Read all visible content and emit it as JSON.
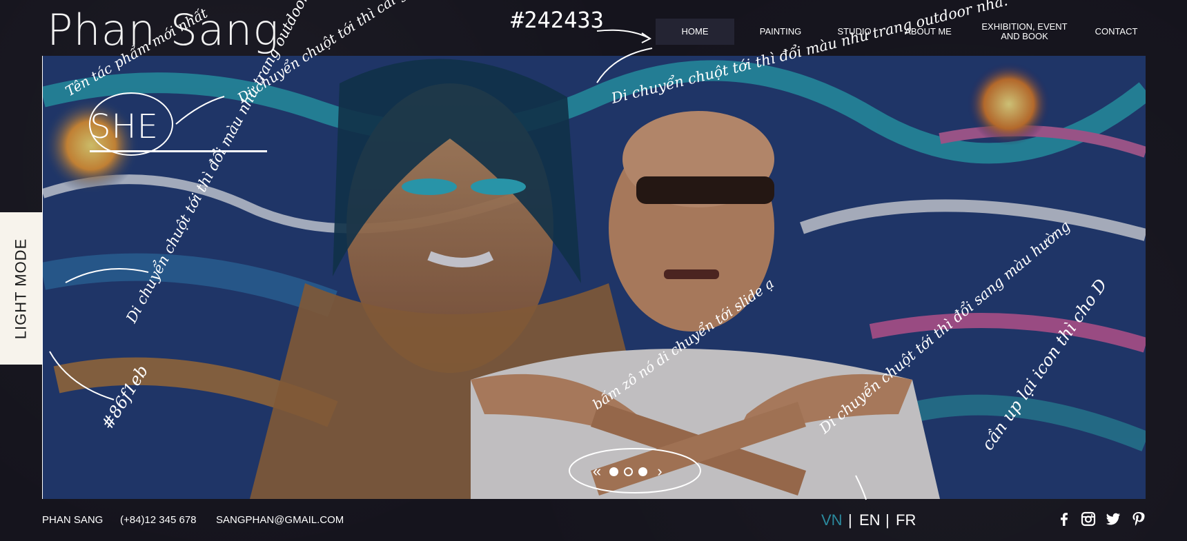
{
  "site": {
    "logo": "Phan Sang"
  },
  "nav": {
    "items": [
      {
        "label": "HOME",
        "active": true
      },
      {
        "label": "PAINTING",
        "active": false
      },
      {
        "label": "STUDIO",
        "active": false
      },
      {
        "label": "ABOUT ME",
        "active": false
      },
      {
        "label": "EXHIBITION, EVENT AND BOOK",
        "active": false
      },
      {
        "label": "CONTACT",
        "active": false
      }
    ],
    "active_bg": "#242433"
  },
  "hero": {
    "slide_title": "SHE",
    "slides_total": 3,
    "current_slide": 1,
    "prev_icon": "double-chevron-left-icon",
    "next_icon": "chevron-right-icon"
  },
  "mode_toggle": {
    "label": "LIGHT MODE"
  },
  "footer": {
    "name": "PHAN SANG",
    "phone": "(+84)12 345 678",
    "email": "SANGPHAN@GMAIL.COM",
    "languages": [
      {
        "code": "VN",
        "active": true
      },
      {
        "code": "EN",
        "active": false
      },
      {
        "code": "FR",
        "active": false
      }
    ],
    "separator": "|",
    "active_lang_color": "#2b8a9e",
    "social": [
      "facebook-icon",
      "instagram-icon",
      "twitter-icon",
      "pinterest-icon"
    ]
  },
  "annotations": {
    "color_code_top": "#242433",
    "color_code_left": "#86f1eb",
    "notes": [
      "Tên tác phẩm mới nhất",
      "Di chuyển chuột tới thì cái gạch chân nó mới thụt ra nha",
      "Di chuyển chuột tới thì đổi màu như trang outdoor nha.",
      "Di chuyển chuột tới thì đổi màu như trang outdoor nha",
      "bấm zô nó di chuyển tới slide ạ",
      "Di chuyển chuột tới thì đổi sang màu hường",
      "cần up lại icon thì cho D"
    ]
  }
}
